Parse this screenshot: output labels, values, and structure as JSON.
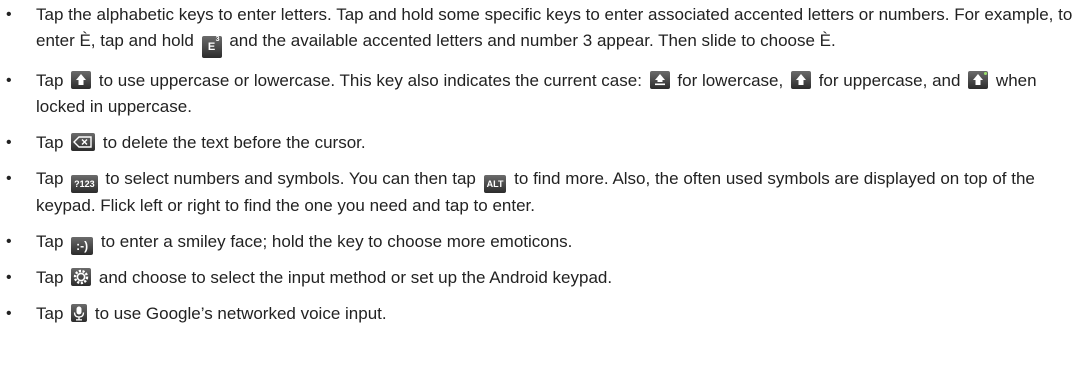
{
  "bullet_char": "•",
  "items": [
    {
      "p1": "Tap the alphabetic keys to enter letters. Tap and hold some specific keys to enter associated accented letters or numbers. For example, to enter È, tap and hold",
      "p2": "and the available accented letters and number 3 appear. Then slide to choose È."
    },
    {
      "p1": "Tap",
      "p2": "to use uppercase or lowercase. This key also indicates the current case:",
      "p3": "for lowercase,",
      "p4": "for uppercase, and",
      "p5": "when locked in uppercase."
    },
    {
      "p1": "Tap",
      "p2": "to delete the text before the cursor."
    },
    {
      "p1": "Tap",
      "p2": "to select numbers and symbols. You can then tap",
      "p3": "to find more. Also, the often used symbols are displayed on top of the keypad. Flick left or right to find the one you need and tap to enter."
    },
    {
      "p1": "Tap",
      "p2": "to enter a smiley face; hold the key to choose more emoticons."
    },
    {
      "p1": "Tap",
      "p2": "and choose to select the input method or set up the Android keypad."
    },
    {
      "p1": "Tap",
      "p2": "to use Google’s networked voice input."
    }
  ],
  "keys": {
    "e_key": "E",
    "e_key_sup": "3",
    "numbers_key": "?123",
    "alt_key": "ALT",
    "smiley_key": ":-)"
  },
  "icons": {
    "shift": "shift-icon",
    "shift_lowercase": "shift-lowercase-icon",
    "shift_uppercase": "shift-uppercase-icon",
    "shift_locked": "shift-locked-icon",
    "delete": "backspace-icon",
    "settings": "gear-icon",
    "mic": "microphone-icon"
  },
  "colors": {
    "key_background": "#3a3a3a",
    "caps_lock_indicator": "#9be26a",
    "text": "#222222"
  }
}
